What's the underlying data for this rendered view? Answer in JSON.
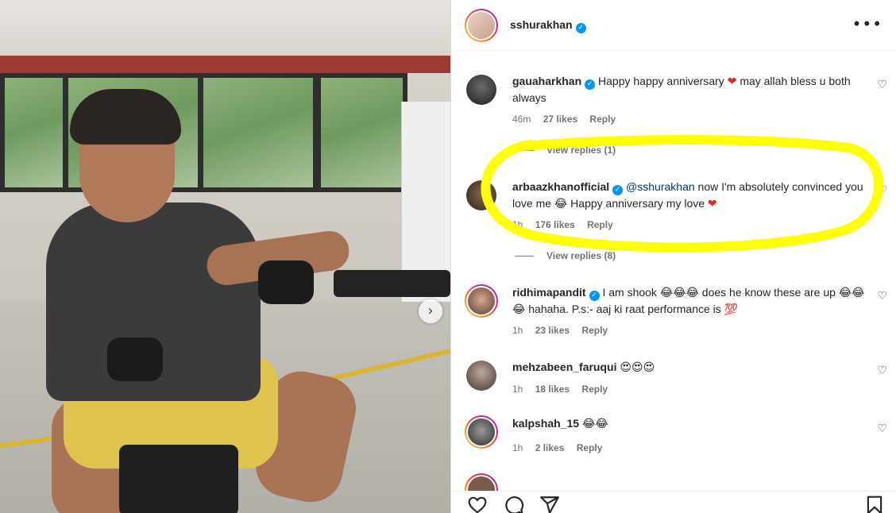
{
  "header": {
    "username": "sshurakhan"
  },
  "photo": {
    "next_icon": "chevron-right-icon"
  },
  "comments": [
    {
      "username": "gauaharkhan",
      "verified": true,
      "text_before_heart": "Happy happy anniversary",
      "text_after_heart": "may allah bless u both always",
      "time": "46m",
      "likes": "27 likes",
      "reply": "Reply",
      "view_replies": "View replies (1)"
    },
    {
      "username": "arbaazkhanofficial",
      "verified": true,
      "mention": "@sshurakhan",
      "text_part1": "now I'm absolutely convinced you love me",
      "text_part2": "Happy anniversary my love",
      "time": "1h",
      "likes": "176 likes",
      "reply": "Reply",
      "view_replies": "View replies (8)"
    },
    {
      "username": "ridhimapandit",
      "verified": true,
      "text_part1": "I am shook",
      "text_part2": "does he know these are up",
      "text_part3": "hahaha. P.s:- aaj ki raat performance is",
      "time": "1h",
      "likes": "23 likes",
      "reply": "Reply"
    },
    {
      "username": "mehzabeen_faruqui",
      "verified": false,
      "text": "",
      "time": "1h",
      "likes": "18 likes",
      "reply": "Reply"
    },
    {
      "username": "kalpshah_15",
      "verified": false,
      "text": "",
      "time": "1h",
      "likes": "2 likes",
      "reply": "Reply"
    }
  ],
  "emoji": {
    "laugh": "😂",
    "heart_eyes": "😍",
    "hundred": "💯",
    "heart": "❤"
  },
  "colors": {
    "highlight": "#ffff00",
    "verified": "#0095f6",
    "link": "#00376b",
    "muted": "#737373"
  },
  "actions": [
    "heart-icon",
    "comment-icon",
    "share-icon",
    "bookmark-icon"
  ]
}
